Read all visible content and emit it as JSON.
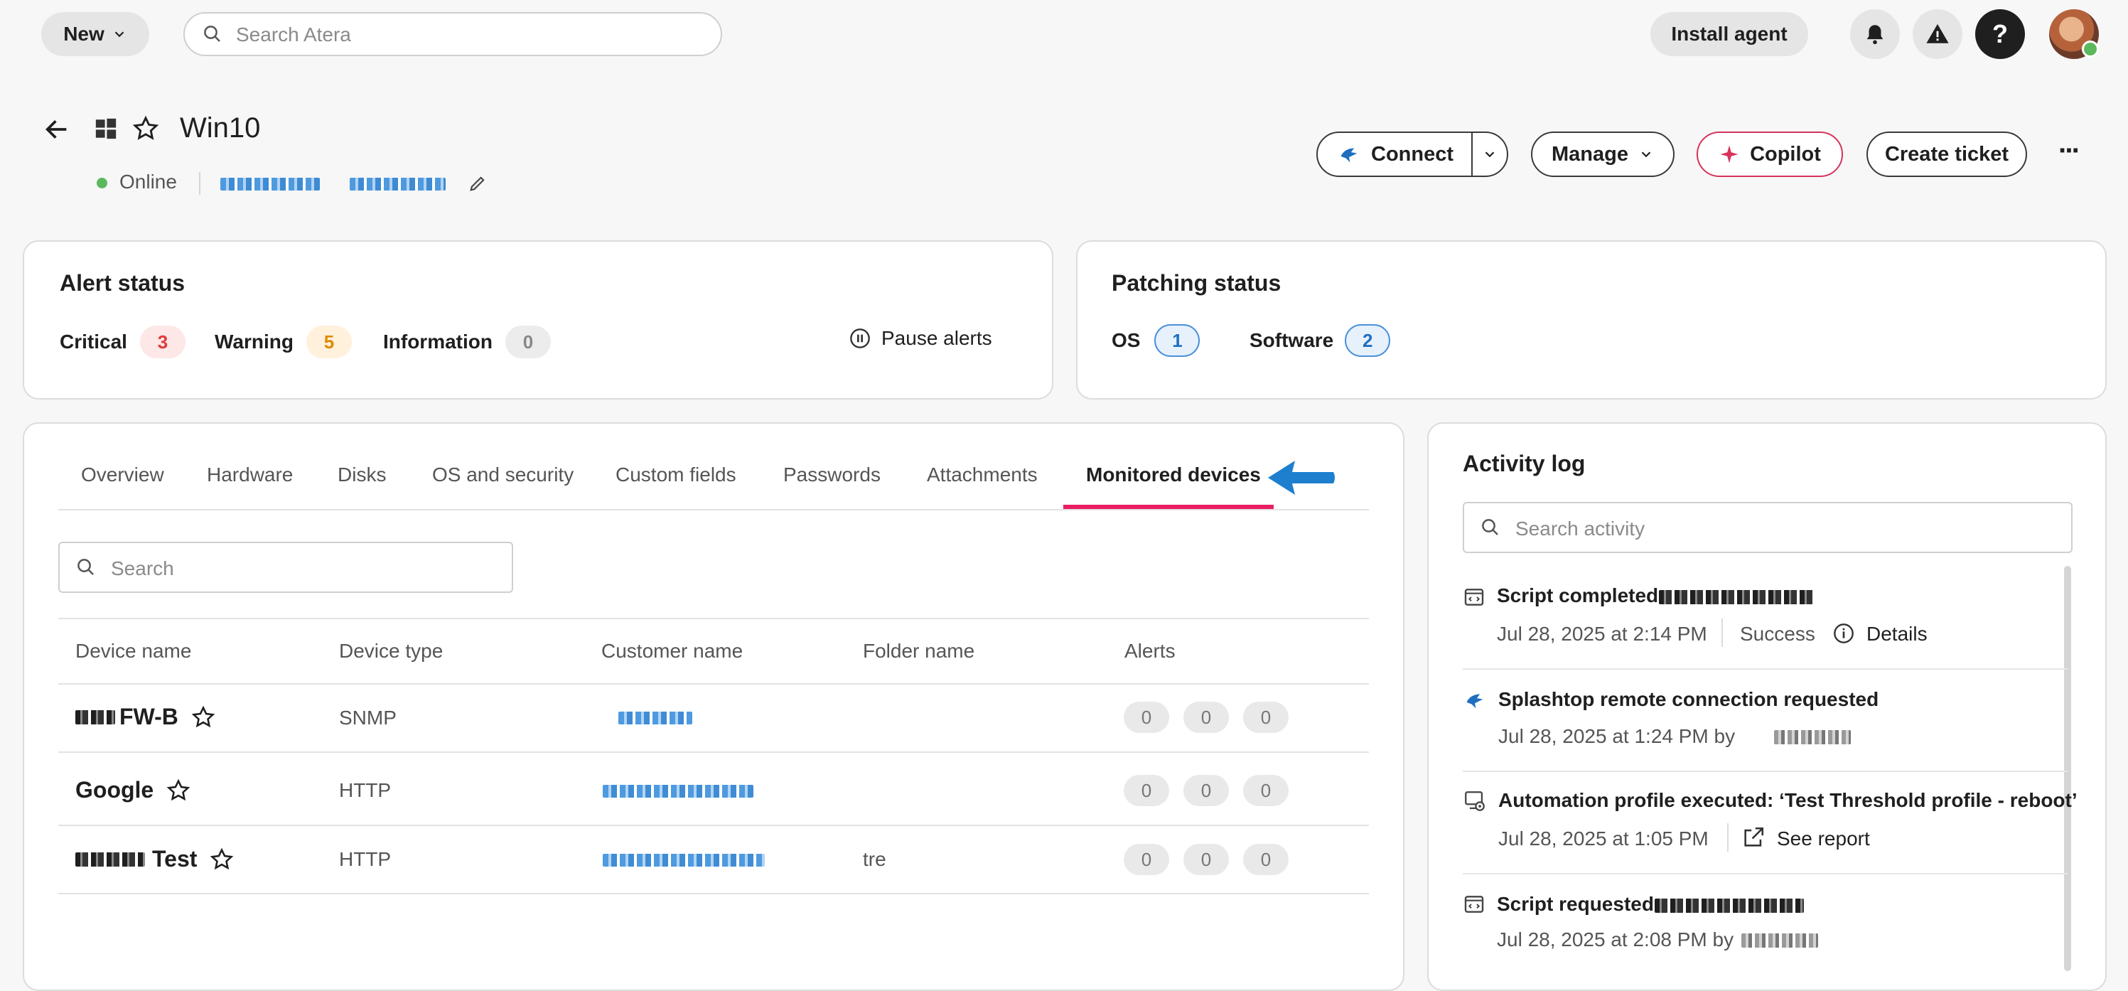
{
  "topbar": {
    "new_label": "New",
    "search_placeholder": "Search Atera",
    "install_agent_label": "Install agent",
    "help_glyph": "?",
    "alert_glyph": "!"
  },
  "device": {
    "name": "Win10",
    "status": "Online",
    "status_color": "#5cb85c"
  },
  "actions": {
    "connect": "Connect",
    "manage": "Manage",
    "copilot": "Copilot",
    "create_ticket": "Create ticket",
    "more": "···"
  },
  "alert_status": {
    "title": "Alert status",
    "critical_label": "Critical",
    "critical_count": "3",
    "warning_label": "Warning",
    "warning_count": "5",
    "information_label": "Information",
    "information_count": "0",
    "pause_label": "Pause alerts"
  },
  "patching_status": {
    "title": "Patching status",
    "os_label": "OS",
    "os_count": "1",
    "software_label": "Software",
    "software_count": "2"
  },
  "tabs": [
    {
      "label": "Overview"
    },
    {
      "label": "Hardware"
    },
    {
      "label": "Disks"
    },
    {
      "label": "OS and security"
    },
    {
      "label": "Custom fields"
    },
    {
      "label": "Passwords"
    },
    {
      "label": "Attachments"
    },
    {
      "label": "Monitored devices"
    }
  ],
  "devices_panel": {
    "search_placeholder": "Search",
    "columns": [
      "Device name",
      "Device type",
      "Customer name",
      "Folder name",
      "Alerts"
    ],
    "rows": [
      {
        "name": "FW-B",
        "type": "SNMP",
        "folder": "",
        "alerts": [
          "0",
          "0",
          "0"
        ]
      },
      {
        "name": "Google",
        "type": "HTTP",
        "folder": "",
        "alerts": [
          "0",
          "0",
          "0"
        ]
      },
      {
        "name": "Test",
        "type": "HTTP",
        "folder": "tre",
        "alerts": [
          "0",
          "0",
          "0"
        ]
      }
    ]
  },
  "activity_log": {
    "title": "Activity log",
    "search_placeholder": "Search activity",
    "entries": [
      {
        "title": "Script completed:",
        "time": "Jul 28, 2025 at 2:14 PM",
        "status": "Success",
        "link": "Details"
      },
      {
        "title": "Splashtop remote connection requested",
        "time": "Jul 28, 2025 at 1:24 PM by"
      },
      {
        "title": "Automation profile executed: ‘Test Threshold profile - reboot’",
        "time": "Jul 28, 2025 at 1:05 PM",
        "link": "See report"
      },
      {
        "title": "Script requested:",
        "time": "Jul 28, 2025 at 2:08 PM by"
      }
    ]
  },
  "colors": {
    "active_tab_underline": "#e91e63",
    "arrow": "#1e7fcf",
    "critical_bg": "#fde7e7",
    "critical_fg": "#e03b3b",
    "warning_bg": "#fff1dc",
    "warning_fg": "#e08a00",
    "info_bg": "#ececec",
    "patch_badge_bg": "#e6f1fc",
    "patch_badge_border": "#4a90d9",
    "patch_badge_fg": "#1f6fc2",
    "copilot_border": "#d6335b"
  }
}
